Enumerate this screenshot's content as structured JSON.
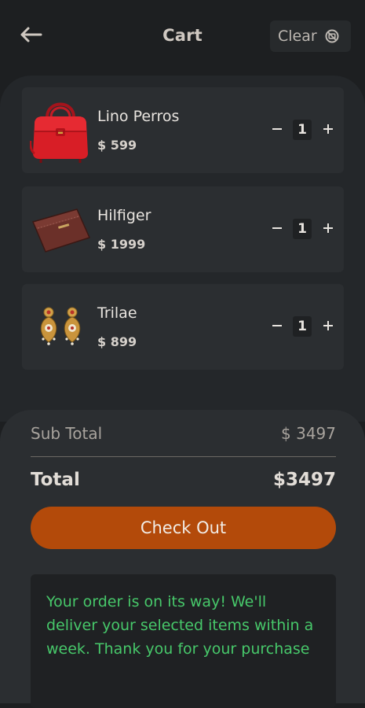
{
  "header": {
    "back_icon": "arrow-left-icon",
    "title": "Cart",
    "clear_label": "Clear",
    "clear_icon": "block-icon"
  },
  "cart": {
    "items": [
      {
        "name": "Lino Perros",
        "price": "$ 599",
        "quantity": "1",
        "image": "red-handbag"
      },
      {
        "name": "Hilfiger",
        "price": "$ 1999",
        "quantity": "1",
        "image": "brown-wallet"
      },
      {
        "name": "Trilae",
        "price": "$ 899",
        "quantity": "1",
        "image": "gold-earrings"
      }
    ]
  },
  "summary": {
    "subtotal_label": "Sub Total",
    "subtotal_value": "$ 3497",
    "total_label": "Total",
    "total_value": "$3497",
    "checkout_label": "Check Out",
    "message": "Your order is on its way! We'll deliver your selected items within a week. Thank you for your purchase"
  },
  "colors": {
    "background": "#1d1f21",
    "card": "#2b2e31",
    "accent": "#b34a0a",
    "message_green": "#47c86a"
  }
}
